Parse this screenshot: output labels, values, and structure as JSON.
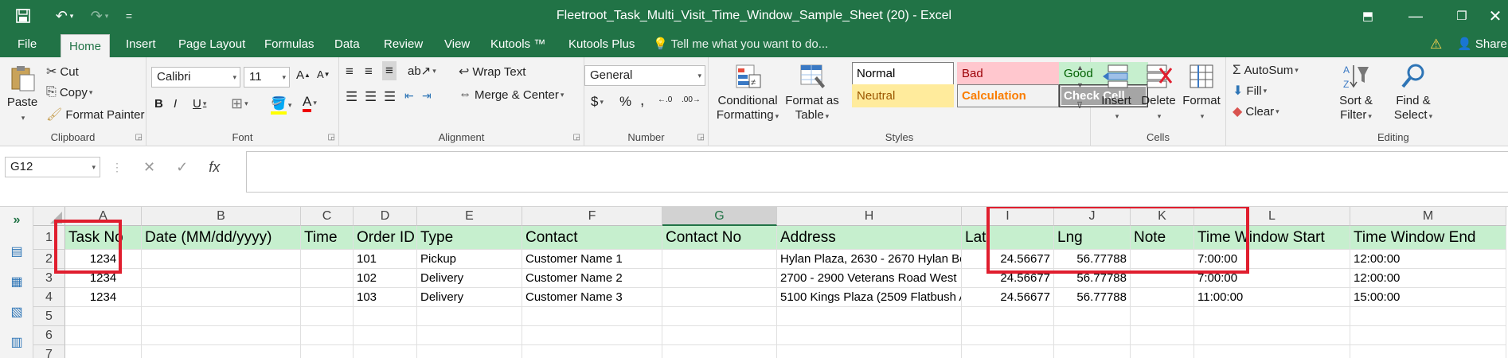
{
  "window": {
    "title": "Fleetroot_Task_Multi_Visit_Time_Window_Sample_Sheet (20) - Excel",
    "qa_customize": "=",
    "share_label": "Share"
  },
  "tabs": [
    "File",
    "Home",
    "Insert",
    "Page Layout",
    "Formulas",
    "Data",
    "Review",
    "View",
    "Kutools ™",
    "Kutools Plus"
  ],
  "tell_me": "Tell me what you want to do...",
  "ribbon": {
    "clipboard": {
      "paste": "Paste",
      "cut": "Cut",
      "copy": "Copy",
      "format_painter": "Format Painter",
      "label": "Clipboard"
    },
    "font": {
      "name": "Calibri",
      "size": "11",
      "bold": "B",
      "italic": "I",
      "underline": "U",
      "label": "Font"
    },
    "alignment": {
      "wrap": "Wrap Text",
      "merge": "Merge & Center",
      "label": "Alignment"
    },
    "number": {
      "format": "General",
      "currency": "$",
      "percent": "%",
      "comma": ",",
      "label": "Number"
    },
    "styles": {
      "conditional": "Conditional\nFormatting",
      "format_table": "Format as\nTable",
      "items": [
        {
          "name": "Normal",
          "bg": "#ffffff",
          "fg": "#000000",
          "border": "#7f7f7f"
        },
        {
          "name": "Bad",
          "bg": "#ffc7ce",
          "fg": "#9c0006",
          "border": "#ffc7ce"
        },
        {
          "name": "Good",
          "bg": "#c6efce",
          "fg": "#006100",
          "border": "#c6efce"
        },
        {
          "name": "Neutral",
          "bg": "#ffeb9c",
          "fg": "#9c5700",
          "border": "#ffeb9c"
        },
        {
          "name": "Calculation",
          "bg": "#f2f2f2",
          "fg": "#fa7d00",
          "border": "#7f7f7f"
        },
        {
          "name": "Check Cell",
          "bg": "#a5a5a5",
          "fg": "#ffffff",
          "border": "#3f3f3f"
        }
      ],
      "label": "Styles"
    },
    "cells": {
      "insert": "Insert",
      "delete": "Delete",
      "format": "Format",
      "label": "Cells"
    },
    "editing": {
      "autosum": "AutoSum",
      "fill": "Fill",
      "clear": "Clear",
      "sort": "Sort &\nFilter",
      "find": "Find &\nSelect",
      "label": "Editing"
    }
  },
  "formula_bar": {
    "name_box": "G12",
    "formula": ""
  },
  "sheet": {
    "columns": [
      "A",
      "B",
      "C",
      "D",
      "E",
      "F",
      "G",
      "H",
      "I",
      "J",
      "K",
      "L",
      "M"
    ],
    "selected_column": "G",
    "rows": [
      "1",
      "2",
      "3",
      "4",
      "5",
      "6",
      "7"
    ],
    "header": [
      "Task No",
      "Date (MM/dd/yyyy)",
      "Time",
      "Order ID",
      "Type",
      "Contact",
      "Contact No",
      "Address",
      "Lat",
      "Lng",
      "Note",
      "Time Window Start",
      "Time Window End"
    ],
    "data": [
      [
        "1234",
        "",
        "",
        "101",
        "Pickup",
        "Customer Name 1",
        "",
        "Hylan Plaza, 2630 - 2670 Hylan Bo",
        "24.56677",
        "56.77788",
        "",
        "7:00:00",
        "12:00:00"
      ],
      [
        "1234",
        "",
        "",
        "102",
        "Delivery",
        "Customer Name 2",
        "",
        "2700 - 2900 Veterans Road West",
        "24.56677",
        "56.77788",
        "",
        "7:00:00",
        "12:00:00"
      ],
      [
        "1234",
        "",
        "",
        "103",
        "Delivery",
        "Customer Name 3",
        "",
        "5100 Kings Plaza (2509 Flatbush A",
        "24.56677",
        "56.77788",
        "",
        "11:00:00",
        "15:00:00"
      ]
    ]
  },
  "accent_color": "#217346",
  "highlight_color": "#e01e2e"
}
